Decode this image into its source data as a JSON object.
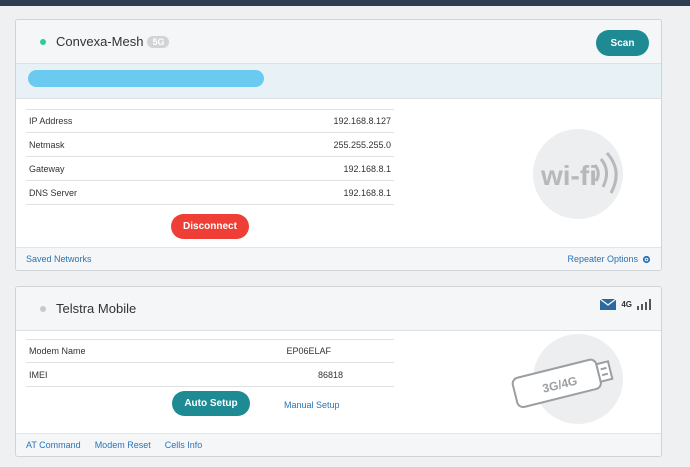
{
  "wifi_card": {
    "title": "Convexa-Mesh",
    "band_badge": "5G",
    "scan_label": "Scan",
    "connection_text": "...",
    "rows": [
      {
        "label": "IP Address",
        "value": "192.168.8.127"
      },
      {
        "label": "Netmask",
        "value": "255.255.255.0"
      },
      {
        "label": "Gateway",
        "value": "192.168.8.1"
      },
      {
        "label": "DNS Server",
        "value": "192.168.8.1"
      }
    ],
    "disconnect_label": "Disconnect",
    "footer_left": "Saved Networks",
    "footer_right": "Repeater Options",
    "status_color": "#2ecc9a",
    "logo_text": "wi-fi"
  },
  "mobile_card": {
    "title": "Telstra Mobile",
    "network_type": "4G",
    "rows": [
      {
        "label": "Modem Name",
        "value": "EP06ELAF"
      },
      {
        "label": "IMEI",
        "value": "86818"
      }
    ],
    "auto_setup_label": "Auto Setup",
    "manual_setup_label": "Manual Setup",
    "footer_links": [
      "AT Command",
      "Modem Reset",
      "Cells Info"
    ],
    "dongle_label": "3G/4G"
  },
  "colors": {
    "accent": "#1e8a94",
    "danger": "#ef3e36",
    "link": "#2a74b5"
  }
}
